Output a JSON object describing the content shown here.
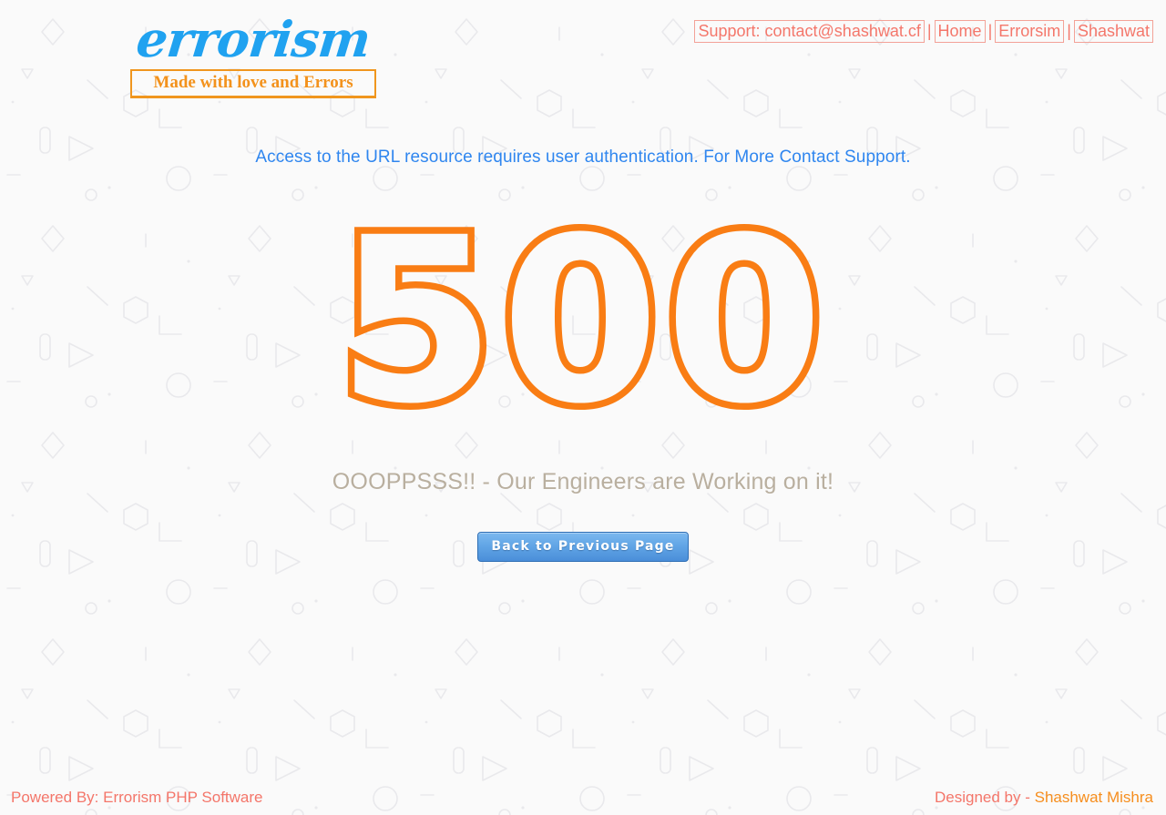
{
  "document_title": "500 - Errorism",
  "colors": {
    "page_background": "#fafafa",
    "pattern_stroke": "#ebebed",
    "logo_blue": "#20a2f0",
    "logo_orange": "#f3921c",
    "nav_salmon": "#f4776b",
    "message_blue": "#2f86ef",
    "code_orange": "#f97d14",
    "submessage_tan": "#b9af9f",
    "button_blue": "#62a6e6",
    "button_border": "#2f6fb5",
    "footer_salmon": "#f4766a",
    "footer_author_orange": "#f68e1e"
  },
  "header": {
    "logo": {
      "word": "errorism",
      "tagline": "Made with love and Errors"
    },
    "nav": {
      "separator": "|",
      "links": [
        {
          "label": "Support: contact@shashwat.cf"
        },
        {
          "label": "Home"
        },
        {
          "label": "Errorsim"
        },
        {
          "label": "Shashwat"
        }
      ]
    }
  },
  "main": {
    "message": "Access to the URL resource requires user authentication. For More Contact Support.",
    "error_code": "500",
    "submessage": "OOOPPSSS!! - Our Engineers are Working on it!",
    "back_button_label": "Back to Previous Page"
  },
  "footer": {
    "powered_by": "Powered By: Errorism PHP Software",
    "designed_by_prefix": "Designed by - ",
    "designed_by_author": "Shashwat Mishra"
  },
  "background_pattern": {
    "motifs": [
      "diamond-outline",
      "triangle-outline",
      "hexagon-outline",
      "circle-outline",
      "corner-bracket",
      "diagonal-line",
      "rounded-rect-outline",
      "small-dot",
      "dash"
    ],
    "tile_size": 227
  }
}
